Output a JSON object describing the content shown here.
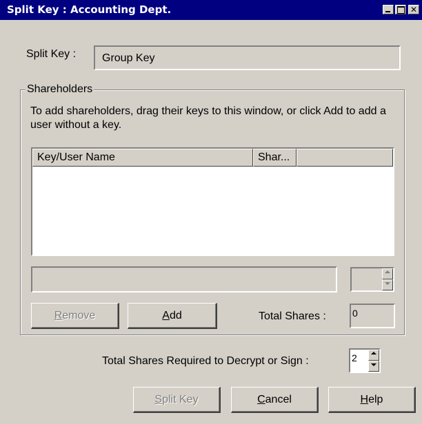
{
  "window": {
    "title": "Split Key : Accounting Dept.",
    "title_bar_color": "#000080",
    "background_color": "#d4d0c8",
    "controls": {
      "minimize_icon": "minimize-icon",
      "maximize_icon": "maximize-icon",
      "close_glyph": "✕"
    }
  },
  "split_key": {
    "label": "Split Key :",
    "value": "Group Key"
  },
  "shareholders": {
    "group_label": "Shareholders",
    "instructions": "To add shareholders, drag their keys to this window, or click Add to add a user without a key.",
    "columns": [
      "Key/User Name",
      "Shar..."
    ],
    "rows": [],
    "selected_name": "",
    "selected_shares": ""
  },
  "buttons": {
    "remove": {
      "underline": "R",
      "rest": "emove"
    },
    "add": {
      "underline": "A",
      "rest": "dd"
    },
    "split_key": {
      "prefix": "",
      "underline": "S",
      "rest": "plit Key"
    },
    "cancel": {
      "underline": "C",
      "rest": "ancel"
    },
    "help": {
      "underline": "H",
      "rest": "elp"
    }
  },
  "total_shares": {
    "label": "Total Shares :",
    "value": "0"
  },
  "required": {
    "label": "Total Shares Required to Decrypt or Sign :",
    "value": "2"
  }
}
